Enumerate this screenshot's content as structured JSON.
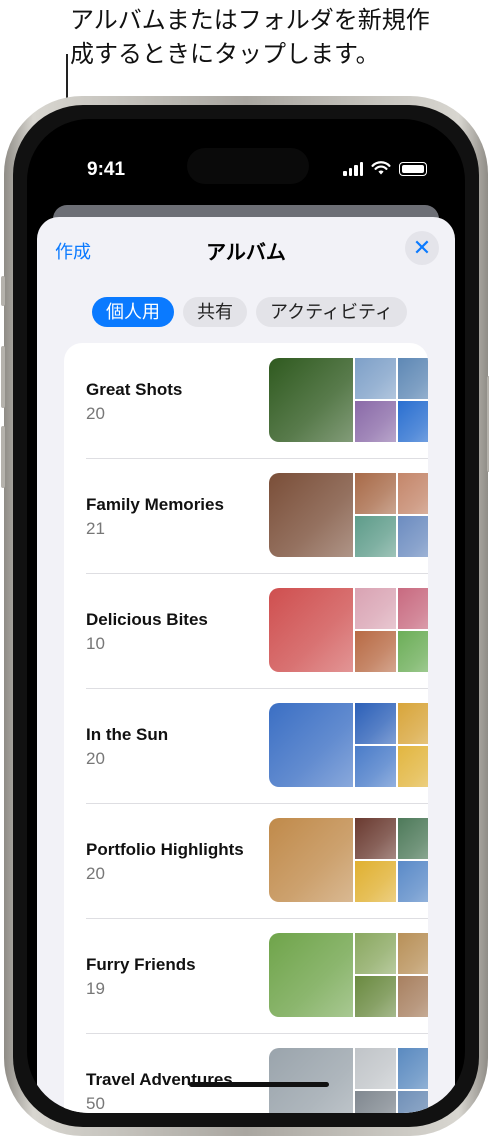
{
  "callout": {
    "text": "アルバムまたはフォルダを新規作成するときにタップします。"
  },
  "status_bar": {
    "time": "9:41"
  },
  "header": {
    "create_label": "作成",
    "title": "アルバム",
    "close_label": "✕"
  },
  "segments": [
    {
      "label": "個人用",
      "selected": true
    },
    {
      "label": "共有",
      "selected": false
    },
    {
      "label": "アクティビティ",
      "selected": false
    }
  ],
  "albums": [
    {
      "name": "Great Shots",
      "count": "20",
      "colors": [
        "#2f5a1f",
        "#7ea0c8",
        "#5e88b5",
        "#8a6aa8",
        "#2a6fd0"
      ]
    },
    {
      "name": "Family Memories",
      "count": "21",
      "colors": [
        "#7a4e38",
        "#a86a48",
        "#c4866a",
        "#5e9c8a",
        "#6c8cc0"
      ]
    },
    {
      "name": "Delicious Bites",
      "count": "10",
      "colors": [
        "#cf4f4f",
        "#d9a3b3",
        "#c86a80",
        "#b86a44",
        "#6cae58"
      ]
    },
    {
      "name": "In the Sun",
      "count": "20",
      "colors": [
        "#3b6fc4",
        "#2c60b8",
        "#d8a53a",
        "#4a7cc9",
        "#e2b640"
      ]
    },
    {
      "name": "Portfolio Highlights",
      "count": "20",
      "colors": [
        "#c08a4a",
        "#6a3a30",
        "#4e7a5a",
        "#e0b030",
        "#5a8ac8"
      ]
    },
    {
      "name": "Furry Friends",
      "count": "19",
      "colors": [
        "#6fa44a",
        "#8aa860",
        "#b89058",
        "#6a8a40",
        "#a88060"
      ]
    },
    {
      "name": "Travel Adventures",
      "count": "50",
      "colors": [
        "#9aa4ac",
        "#c0c4c8",
        "#5a8ac0",
        "#808890",
        "#7090b8"
      ]
    }
  ]
}
